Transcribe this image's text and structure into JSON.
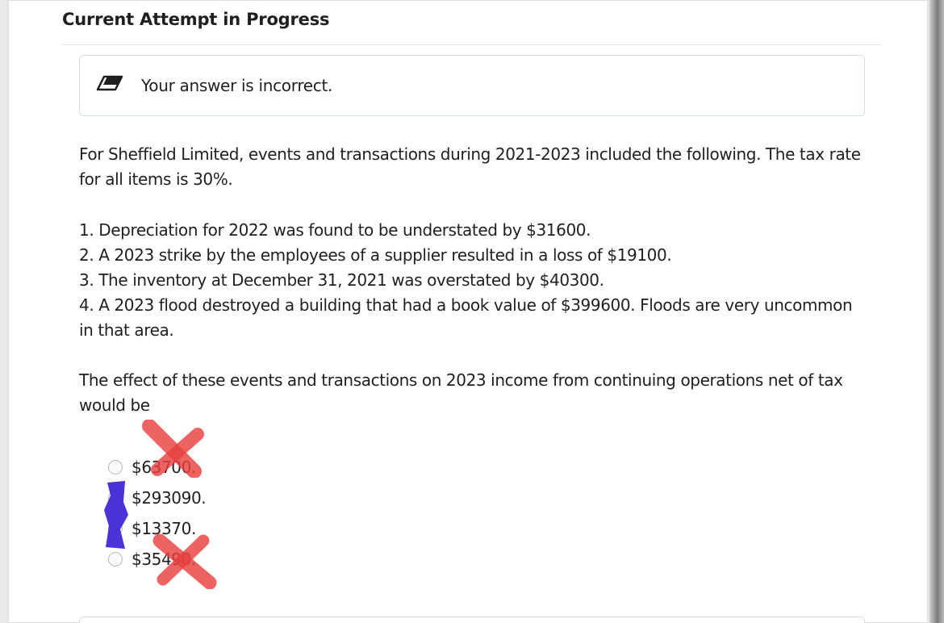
{
  "section": {
    "title": "Current Attempt in Progress"
  },
  "feedback": {
    "icon": "eraser-icon",
    "message": "Your answer is incorrect."
  },
  "question": {
    "intro": "For Sheffield Limited, events and transactions during 2021-2023 included the following. The tax rate for all items is 30%.",
    "items": [
      "1. Depreciation for 2022 was found to be understated by $31600.",
      "2. A 2023 strike by the employees of a supplier resulted in a loss of $19100.",
      "3. The inventory at December 31, 2021 was overstated by $40300.",
      "4. A 2023 flood destroyed a building that had a book value of $399600. Floods are very uncommon in that area."
    ],
    "prompt": "The effect of these events and transactions on 2023 income from continuing operations net of tax would be"
  },
  "options": [
    {
      "label": "$63700."
    },
    {
      "label": "$293090."
    },
    {
      "label": "$13370."
    },
    {
      "label": "$35490."
    }
  ],
  "colors": {
    "cross_mark": "#e8413f",
    "scribble": "#3a22d6",
    "feedback_border": "#cfe0ea"
  }
}
